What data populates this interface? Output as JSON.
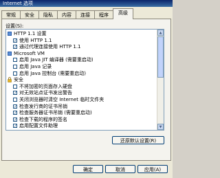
{
  "window": {
    "title": "Internet 选项"
  },
  "tabs": [
    "常规",
    "安全",
    "隐私",
    "内容",
    "连接",
    "程序",
    "高级"
  ],
  "settings_label": "设置(S):",
  "rows": [
    {
      "kind": "category",
      "label": "HTTP 1.1 设置"
    },
    {
      "kind": "checkbox",
      "checked": true,
      "label": "使用 HTTP 1.1"
    },
    {
      "kind": "checkbox",
      "checked": true,
      "label": "通过代理连接使用 HTTP 1.1"
    },
    {
      "kind": "category",
      "label": "Microsoft VM"
    },
    {
      "kind": "checkbox",
      "checked": false,
      "label": "启用 Java JIT 编译器 (需要重启动)"
    },
    {
      "kind": "checkbox",
      "checked": false,
      "label": "启用 Java 记录"
    },
    {
      "kind": "checkbox",
      "checked": false,
      "label": "启用 Java 控制台 (需要重启动)"
    },
    {
      "kind": "lock",
      "label": "安全"
    },
    {
      "kind": "checkbox",
      "checked": false,
      "label": "不将加密的页面存入硬盘"
    },
    {
      "kind": "checkbox",
      "checked": true,
      "label": "对无效站点证书发出警告"
    },
    {
      "kind": "checkbox",
      "checked": false,
      "label": "关闭浏览器时清空 Internet 临时文件夹"
    },
    {
      "kind": "checkbox",
      "checked": true,
      "label": "检查发行商的证书吊销"
    },
    {
      "kind": "checkbox",
      "checked": true,
      "label": "检查服务器证书吊销 (需要重启动)"
    },
    {
      "kind": "checkbox",
      "checked": true,
      "label": "检查下载的程序的签名"
    },
    {
      "kind": "checkbox",
      "checked": true,
      "label": "启用配置文件助理"
    }
  ],
  "buttons": {
    "restore_defaults": "还原默认设置(R)",
    "ok": "确定",
    "cancel": "取消",
    "apply": "应用(A)"
  }
}
